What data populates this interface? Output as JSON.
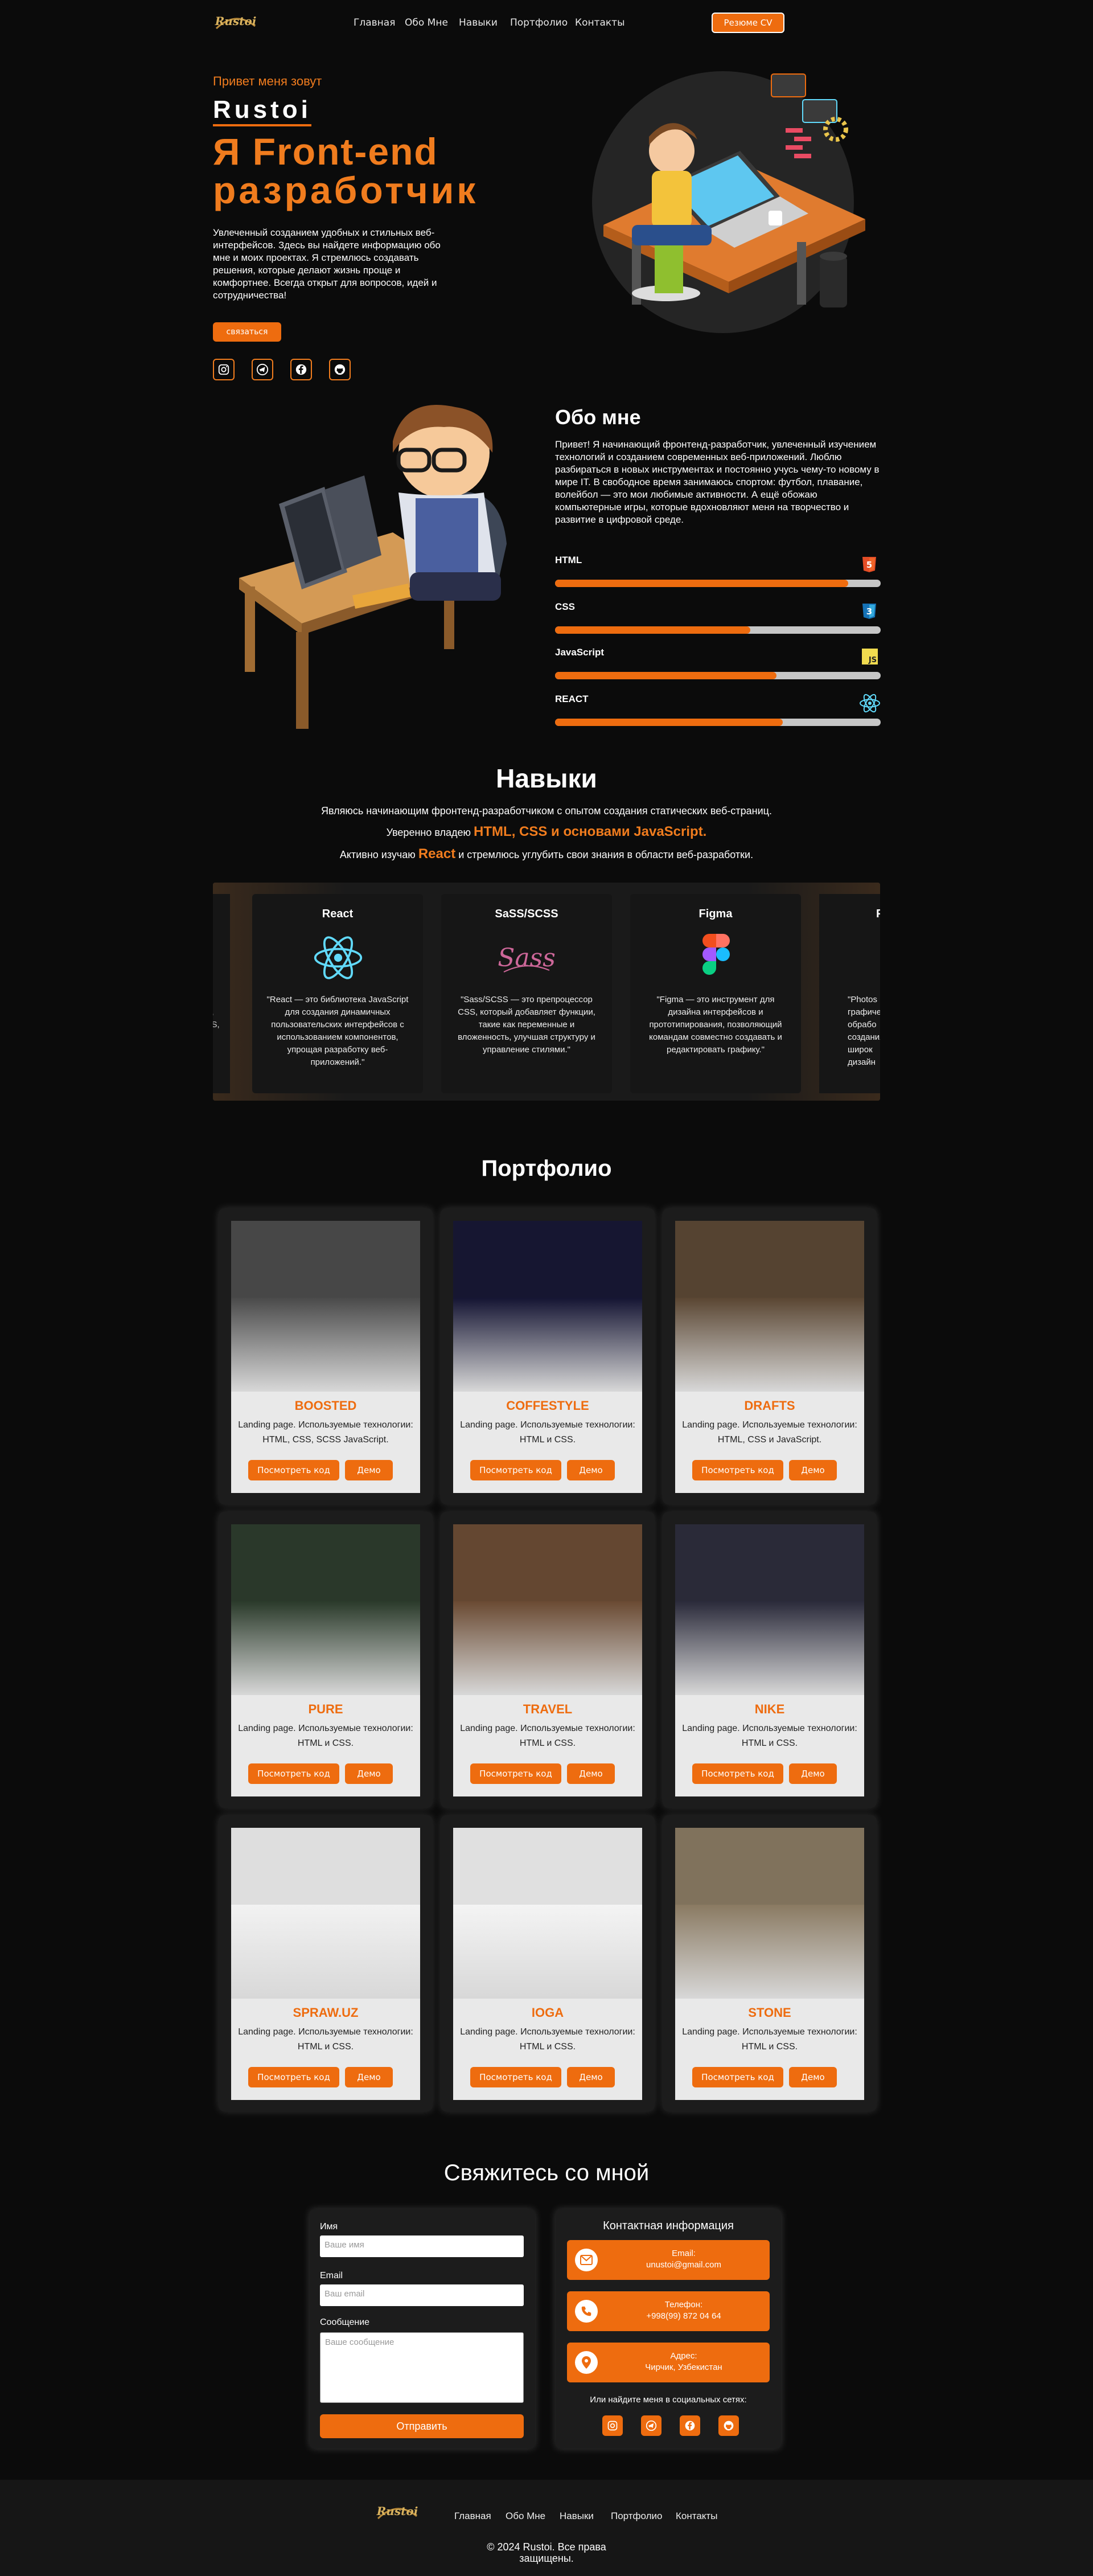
{
  "header": {
    "logo": "Rustoi",
    "nav": [
      "Главная",
      "Обо Мне",
      "Навыки",
      "Портфолио",
      "Контакты"
    ],
    "cv_button": "Резюме CV"
  },
  "hero": {
    "greeting": "Привет меня зовут",
    "name": "Rustoi",
    "title_line1": "Я Front-end",
    "title_line2": "разработчик",
    "text": "Увлеченный созданием удобных и стильных веб-интерфейсов. Здесь вы найдете информацию обо мне и моих проектах. Я стремлюсь создавать решения, которые делают жизнь проще и комфортнее. Всегда открыт для вопросов, идей и сотрудничества!",
    "contact_button": "связаться",
    "socials": [
      "instagram-icon",
      "telegram-icon",
      "facebook-icon",
      "github-icon"
    ]
  },
  "about": {
    "heading": "Обо мне",
    "text": "Привет! Я начинающий фронтенд-разработчик, увлеченный изучением технологий и созданием современных веб-приложений. Люблю разбираться в новых инструментах и постоянно учусь чему-то новому в мире IT. В свободное время занимаюсь спортом: футбол, плавание, волейбол — это мои любимые активности. А ещё обожаю компьютерные игры, которые вдохновляют меня на творчество и развитие в цифровой среде.",
    "skills": [
      {
        "name": "HTML",
        "level": 0.9,
        "icon": "html5-icon",
        "color": "#e44d26"
      },
      {
        "name": "CSS",
        "level": 0.6,
        "icon": "css3-icon",
        "color": "#1572b6"
      },
      {
        "name": "JavaScript",
        "level": 0.68,
        "icon": "js-icon",
        "color": "#f0db4f"
      },
      {
        "name": "REACT",
        "level": 0.7,
        "icon": "react-icon",
        "color": "#61dafb"
      }
    ]
  },
  "skills": {
    "heading": "Навыки",
    "line1": "Являюсь начинающим фронтенд-разработчиком с опытом создания статических веб-страниц.",
    "line2_pre": "Уверенно владею",
    "line2_hl": "HTML, CSS и основами JavaScript.",
    "line3_pre": "Активно изучаю",
    "line3_hl": "React",
    "line3_post": "и стремлюсь углубить свои знания в области веб-разработки.",
    "cards": [
      {
        "title": "React",
        "text": "\"React — это библиотека JavaScript для создания динамичных пользовательских интерфейсов с использованием компонентов, упрощая разработку веб-приложений.\"",
        "icon": "react-icon"
      },
      {
        "title": "SaSS/SCSS",
        "text": "\"Sass/SCSS — это препроцессор CSS, который добавляет функции, такие как переменные и вложенность, улучшая структуру и управление стилями.\"",
        "icon": "sass-icon"
      },
      {
        "title": "Figma",
        "text": "\"Figma — это инструмент для дизайна интерфейсов и прототипирования, позволяющий командам совместно создавать и редактировать графику.\"",
        "icon": "figma-icon"
      }
    ],
    "partial_left_text": "...-s, JS, ...",
    "partial_right_title": "P",
    "partial_right_text": "\"Photos графиче обрабо создания широк дизайн"
  },
  "portfolio": {
    "heading": "Портфолио",
    "code_button": "Посмотреть код",
    "demo_button": "Демо",
    "projects": [
      {
        "title": "BOOSTED",
        "desc": "Landing page. Используемые технологии: HTML, CSS, SCSS JavaScript.",
        "shot": "#4a4a4a"
      },
      {
        "title": "COFFESTYLE",
        "desc": "Landing page. Используемые технологии: HTML и CSS.",
        "shot": "#141432"
      },
      {
        "title": "DRAFTS",
        "desc": "Landing page. Используемые технологии: HTML, CSS и JavaScript.",
        "shot": "#5a4632"
      },
      {
        "title": "PURE",
        "desc": "Landing page. Используемые технологии: HTML и CSS.",
        "shot": "#2a3a2a"
      },
      {
        "title": "TRAVEL",
        "desc": "Landing page. Используемые технологии: HTML и CSS.",
        "shot": "#6a4a32"
      },
      {
        "title": "NIKE",
        "desc": "Landing page. Используемые технологии: HTML и CSS.",
        "shot": "#2a2a3a"
      },
      {
        "title": "SPRAW.UZ",
        "desc": "Landing page. Используемые технологии: HTML и CSS.",
        "shot": "#f2f2f2"
      },
      {
        "title": "IOGA",
        "desc": "Landing page. Используемые технологии: HTML и CSS.",
        "shot": "#f4f4f4"
      },
      {
        "title": "STONE",
        "desc": "Landing page. Используемые технологии: HTML и CSS.",
        "shot": "#8a7a62"
      }
    ]
  },
  "contact": {
    "heading": "Свяжитесь со мной",
    "name_label": "Имя",
    "name_placeholder": "Ваше имя",
    "email_label": "Email",
    "email_placeholder": "Ваш email",
    "message_label": "Сообщение",
    "message_placeholder": "Ваше сообщение",
    "submit": "Отправить",
    "info_heading": "Контактная информация",
    "email_title": "Email:",
    "email_value": "unustoi@gmail.com",
    "phone_title": "Телефон:",
    "phone_value": "+998(99) 872 04 64",
    "address_title": "Адрес:",
    "address_value": "Чирчик, Узбекистан",
    "socials_heading": "Или найдите меня в социальных сетях:"
  },
  "footer": {
    "logo": "Rustoi",
    "nav": [
      "Главная",
      "Обо Мне",
      "Навыки",
      "Портфолио",
      "Контакты"
    ],
    "copyright_line1": "© 2024 Rustoi. Все права",
    "copyright_line2": "защищены."
  }
}
